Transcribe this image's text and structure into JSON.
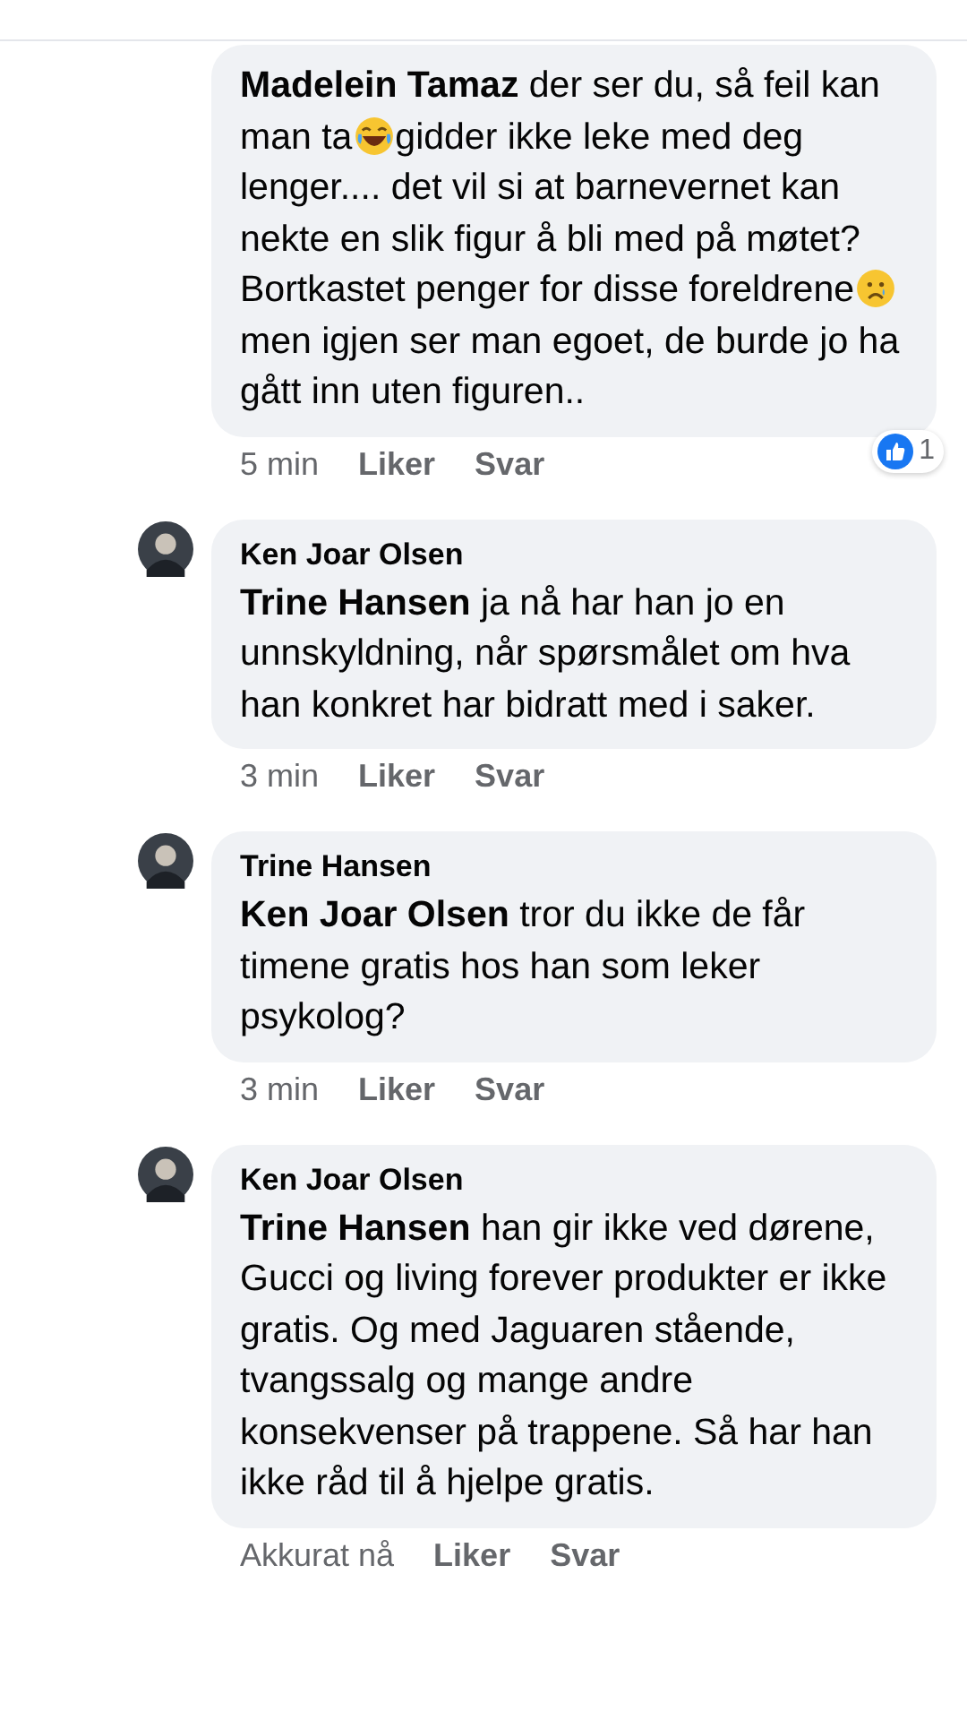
{
  "comments": [
    {
      "kind": "comment",
      "author": "Madelein Tamaz",
      "body": [
        {
          "kind": "text",
          "text": "der ser du, så feil kan man ta"
        },
        {
          "kind": "laugh"
        },
        {
          "kind": "text",
          "text": "gidder ikke leke med deg lenger.... det vil si at barnevernet kan nekte en slik figur å bli med på møtet? Bortkastet penger for disse foreldrene"
        },
        {
          "kind": "sad"
        },
        {
          "kind": "text",
          "text": "men igjen ser man egoet, de burde jo ha gått inn uten figuren.."
        }
      ],
      "time": "5 min",
      "like": "Liker",
      "reply": "Svar",
      "reactions": "1"
    },
    {
      "kind": "reply",
      "author": "Ken Joar Olsen",
      "mention": "Trine Hansen",
      "body": [
        {
          "kind": "text",
          "text": "ja nå har han jo en unnskyldning, når spørsmålet om hva han konkret har bidratt med i saker."
        }
      ],
      "time": "3 min",
      "like": "Liker",
      "reply": "Svar"
    },
    {
      "kind": "reply",
      "author": "Trine Hansen",
      "mention": "Ken Joar Olsen",
      "body": [
        {
          "kind": "text",
          "text": "tror du ikke de får timene gratis hos han som leker psykolog?"
        }
      ],
      "time": "3 min",
      "like": "Liker",
      "reply": "Svar"
    },
    {
      "kind": "reply",
      "author": "Ken Joar Olsen",
      "mention": "Trine Hansen",
      "body": [
        {
          "kind": "text",
          "text": "han gir ikke ved dørene, Gucci og living forever produkter er ikke gratis. Og med Jaguaren stående,  tvangssalg og mange andre konsekvenser på trappene. Så har han ikke råd til å hjelpe gratis."
        }
      ],
      "time": "Akkurat nå",
      "like": "Liker",
      "reply": "Svar"
    }
  ]
}
